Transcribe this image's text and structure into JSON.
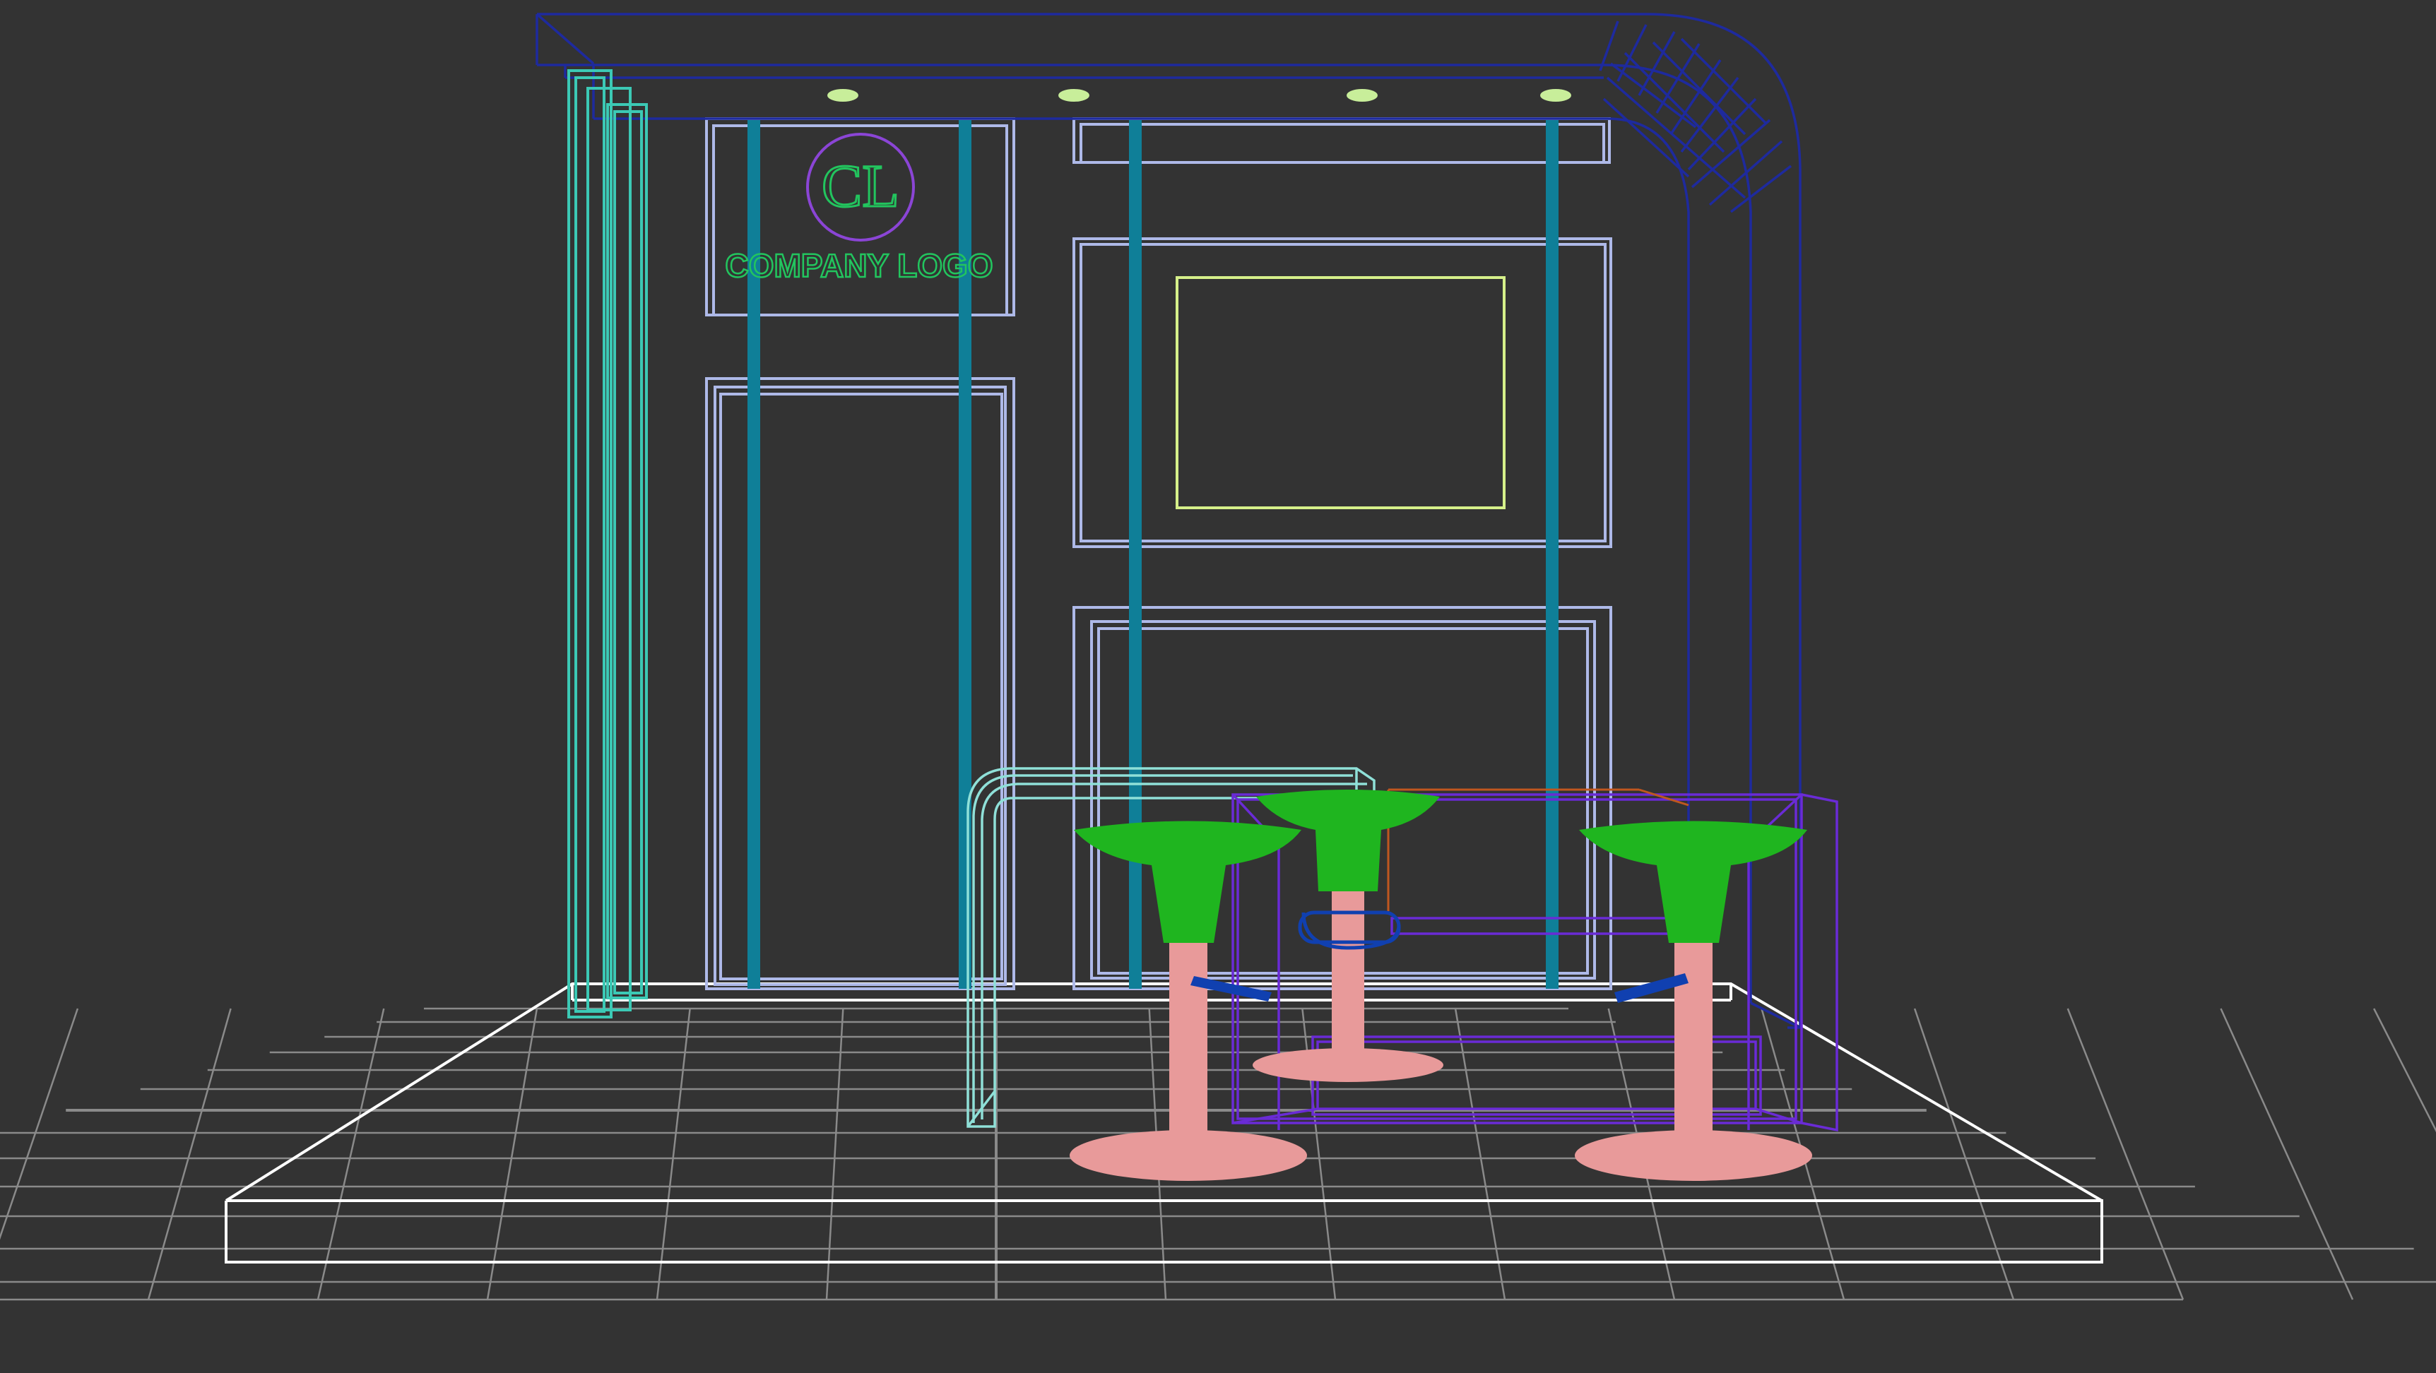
{
  "viewport": {
    "background": "#333333",
    "view_mode": "wireframe-perspective"
  },
  "logo": {
    "monogram": "CL",
    "text": "COMPANY LOGO",
    "text_color": "#22c55e",
    "ring_color": "#8b45d6"
  },
  "colors": {
    "grid": "#8a8a8a",
    "platform": "#ffffff",
    "ceiling": "#1e2a9e",
    "panels": "#aeb9e8",
    "posts": "#0f7f98",
    "left_column": "#3cc9b5",
    "screen": "#d6f08a",
    "spotlights": "#c8ee9a",
    "counter": "#8fe0d8",
    "table": "#6a2bd6",
    "table_edge": "#c0571f",
    "stool_seat": "#1fb51f",
    "stool_stem": "#e89a9a",
    "footrest": "#1040b0"
  },
  "objects": {
    "stools": 3,
    "spotlights": 4,
    "posts": 4
  }
}
